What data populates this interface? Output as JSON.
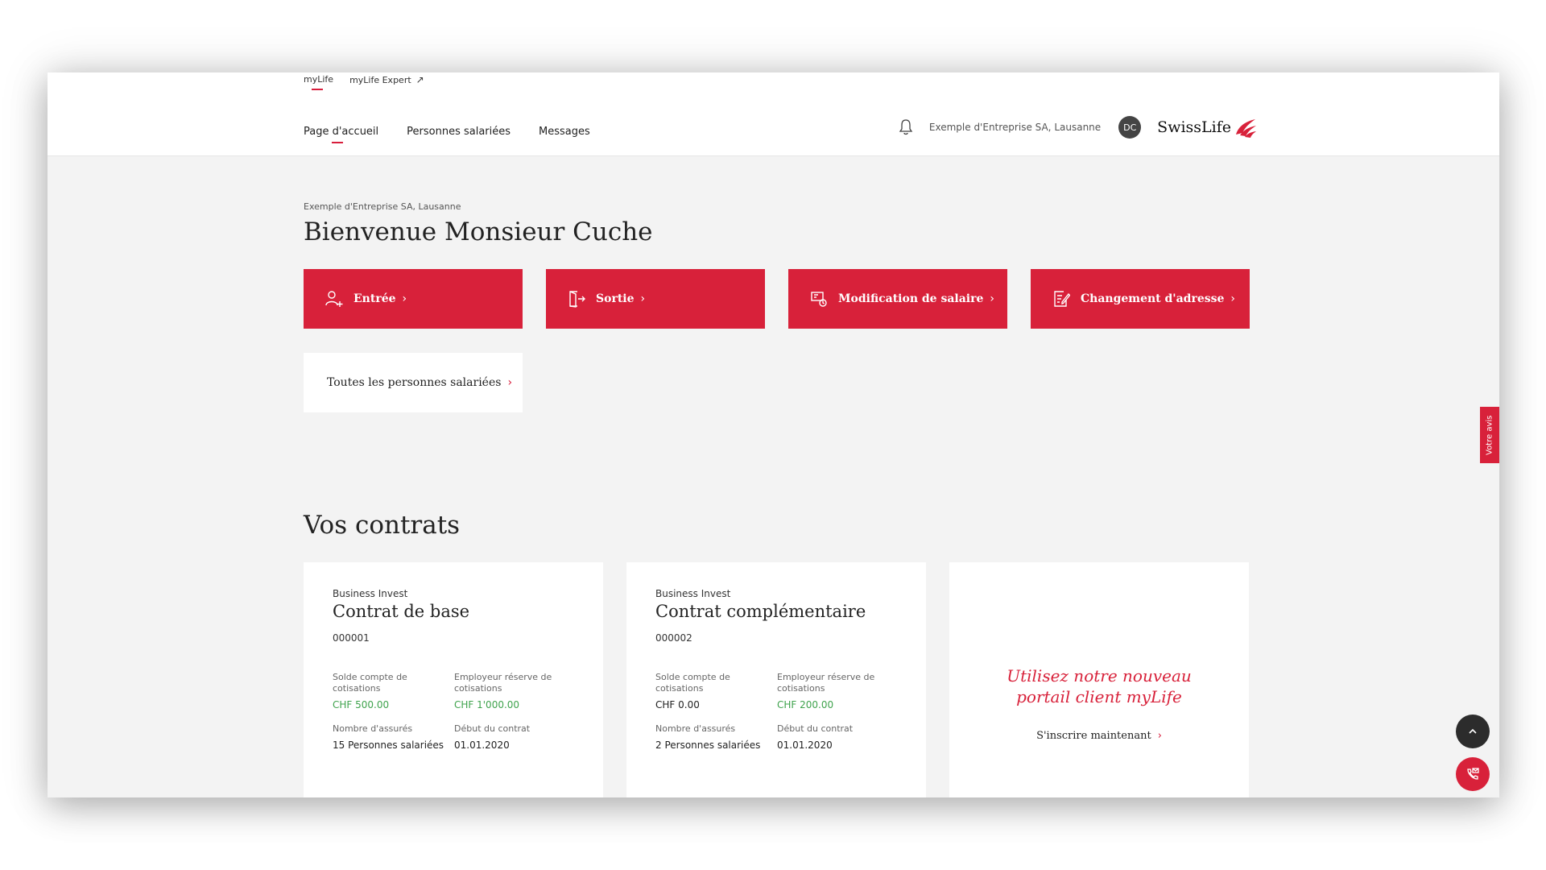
{
  "header": {
    "portal_tabs": [
      {
        "label": "myLife",
        "active": true
      },
      {
        "label": "myLife Expert",
        "active": false,
        "external": true
      }
    ],
    "nav": [
      {
        "label": "Page d'accueil",
        "active": true
      },
      {
        "label": "Personnes salariées",
        "active": false
      },
      {
        "label": "Messages",
        "active": false
      }
    ],
    "company": "Exemple d'Entreprise SA, Lausanne",
    "avatar_initials": "DC",
    "brand": "SwissLife",
    "icons": {
      "notification": "bell-icon",
      "brand_mark": "swisslife-flag-icon"
    }
  },
  "main": {
    "company_crumb": "Exemple d'Entreprise SA, Lausanne",
    "welcome_title": "Bienvenue Monsieur Cuche",
    "actions": [
      {
        "label": "Entrée",
        "icon": "person-add-icon"
      },
      {
        "label": "Sortie",
        "icon": "exit-door-icon"
      },
      {
        "label": "Modification de salaire",
        "icon": "salary-change-icon"
      },
      {
        "label": "Changement d'adresse",
        "icon": "address-edit-icon"
      }
    ],
    "all_persons_label": "Toutes les personnes salariées",
    "contracts_title": "Vos contrats",
    "contracts": [
      {
        "kicker": "Business Invest",
        "title": "Contrat de base",
        "number": "000001",
        "fields": [
          {
            "label": "Solde compte de cotisations",
            "value": "CHF 500.00",
            "green": true
          },
          {
            "label": "Employeur réserve de cotisations",
            "value": "CHF 1'000.00",
            "green": true
          },
          {
            "label": "Nombre d'assurés",
            "value": "15 Personnes salariées",
            "green": false
          },
          {
            "label": "Début du contrat",
            "value": "01.01.2020",
            "green": false
          }
        ]
      },
      {
        "kicker": "Business Invest",
        "title": "Contrat complémentaire",
        "number": "000002",
        "fields": [
          {
            "label": "Solde compte de cotisations",
            "value": "CHF 0.00",
            "green": false
          },
          {
            "label": "Employeur réserve de cotisations",
            "value": "CHF 200.00",
            "green": true
          },
          {
            "label": "Nombre d'assurés",
            "value": "2 Personnes salariées",
            "green": false
          },
          {
            "label": "Début du contrat",
            "value": "01.01.2020",
            "green": false
          }
        ]
      }
    ],
    "promo": {
      "text": "Utilisez notre nouveau portail client myLife",
      "link": "S'inscrire maintenant"
    }
  },
  "widgets": {
    "feedback_label": "Votre avis",
    "scroll_top_icon": "chevron-up-icon",
    "contact_icon": "phone-mail-icon"
  },
  "colors": {
    "brand_red": "#d8213a",
    "positive_green": "#3fa34d",
    "background": "#f3f3f3"
  }
}
